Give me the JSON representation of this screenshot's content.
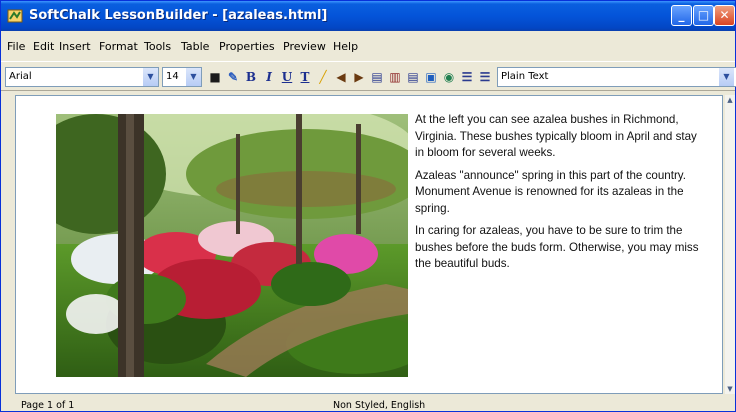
{
  "window": {
    "title": "SoftChalk LessonBuilder - [azaleas.html]"
  },
  "menu": [
    "File",
    "Edit",
    "Insert",
    "Format",
    "Tools",
    "Table",
    "Properties",
    "Preview",
    "Help"
  ],
  "toolbar": {
    "font_name": "Arial",
    "font_size": "14",
    "style": "Plain Text",
    "icons": [
      "save-icon",
      "spellcheck-icon",
      "bold-icon",
      "italic-icon",
      "underline-icon",
      "font-color-icon",
      "highlight-icon",
      "outdent-icon",
      "indent-icon",
      "align-left-icon",
      "align-center-icon",
      "align-right-icon",
      "insert-image-icon",
      "insert-link-icon",
      "numbered-list-icon",
      "bullet-list-icon"
    ]
  },
  "document": {
    "image_alt": "azalea bushes in a garden",
    "paragraphs": [
      "At the left you can see azalea bushes in Richmond, Virginia. These bushes typically bloom in April and stay in bloom for several weeks.",
      "Azaleas \"announce\" spring in this part of the country. Monument Avenue is renowned for its azaleas in the spring.",
      "In caring for azaleas, you have to be sure to trim the bushes before the buds form. Otherwise, you may miss the beautiful buds."
    ]
  },
  "status": {
    "page": "Page 1 of 1",
    "style": "Non Styled, English"
  }
}
